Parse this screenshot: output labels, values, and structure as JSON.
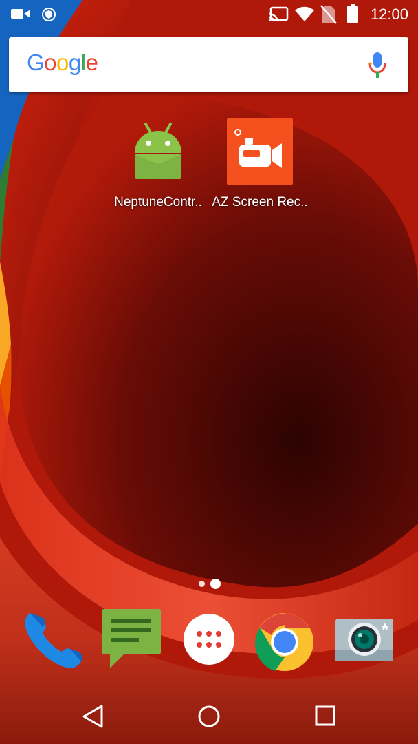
{
  "status_bar": {
    "time": "12:00",
    "left_icons": [
      "video-camera-icon",
      "shield-icon"
    ],
    "right_icons": [
      "cast-icon",
      "wifi-icon",
      "no-sim-icon",
      "battery-icon"
    ]
  },
  "search": {
    "logo_letters": [
      "G",
      "o",
      "o",
      "g",
      "l",
      "e"
    ],
    "logo_colors": [
      "#4285F4",
      "#EA4335",
      "#FBBC05",
      "#4285F4",
      "#34A853",
      "#EA4335"
    ],
    "mic_icon": "mic-icon"
  },
  "home_apps": [
    {
      "label": "NeptuneContr..",
      "icon": "android-icon",
      "color": "#8BC34A"
    },
    {
      "label": "AZ Screen Rec..",
      "icon": "video-recorder-icon",
      "color": "#F4511E"
    }
  ],
  "page_indicator": {
    "pages": 2,
    "current": 2
  },
  "dock": [
    {
      "name": "Phone",
      "icon": "phone-icon",
      "color": "#1E88E5"
    },
    {
      "name": "Messages",
      "icon": "messages-icon",
      "color": "#7CB342"
    },
    {
      "name": "Apps",
      "icon": "app-drawer-icon",
      "color": "#FFFFFF"
    },
    {
      "name": "Chrome",
      "icon": "chrome-icon",
      "color": "#4285F4"
    },
    {
      "name": "Camera",
      "icon": "camera-icon",
      "color": "#B0BEC5"
    }
  ],
  "nav_bar": {
    "buttons": [
      "back-icon",
      "home-icon",
      "recents-icon"
    ]
  }
}
